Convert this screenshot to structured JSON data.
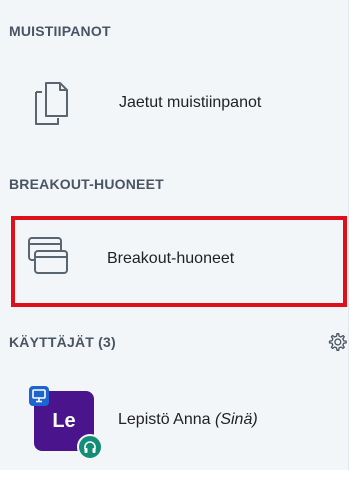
{
  "sections": {
    "notes": {
      "title": "MUISTIIPANOT",
      "item_label": "Jaetut muistiinpanot"
    },
    "breakout": {
      "title": "BREAKOUT-HUONEET",
      "item_label": "Breakout-huoneet"
    },
    "users": {
      "title": "KÄYTTÄJÄT (3)",
      "current_user": {
        "initials": "Le",
        "name": "Lepistö Anna",
        "self_tag": "(Sinä)"
      }
    }
  },
  "colors": {
    "avatar": "#4a148c",
    "presenter_badge": "#1e64d0",
    "audio_badge": "#138d75",
    "highlight": "#e0101a"
  },
  "icons": {
    "notes": "shared-notes-icon",
    "breakout": "breakout-rooms-icon",
    "settings": "gear-icon",
    "presenter": "presenter-icon",
    "audio": "headphones-icon"
  }
}
